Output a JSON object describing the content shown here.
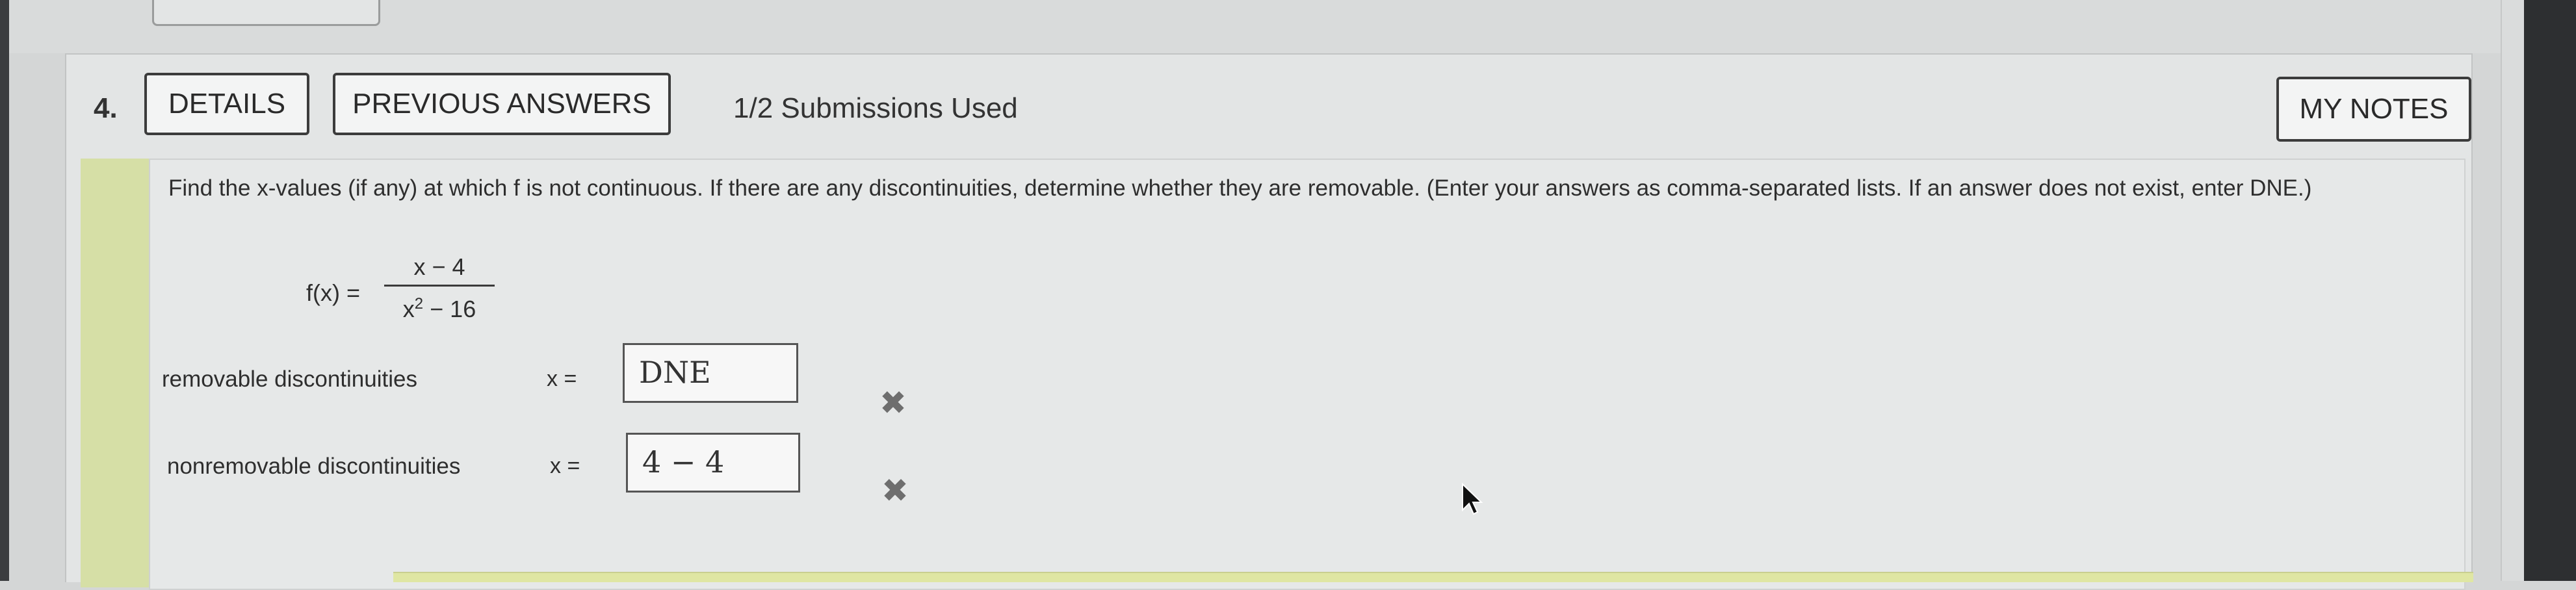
{
  "question": {
    "number": "4.",
    "details_label": "DETAILS",
    "previous_answers_label": "PREVIOUS ANSWERS",
    "submissions": "1/2 Submissions Used",
    "my_notes_label": "MY NOTES",
    "prompt": "Find the x-values (if any) at which f is not continuous. If there are any discontinuities, determine whether they are removable. (Enter your answers as comma-separated lists. If an answer does not exist, enter DNE.)",
    "function": {
      "lhs": "f(x) =",
      "numerator": "x − 4",
      "denominator_base": "x",
      "denominator_exp": "2",
      "denominator_rest": " − 16"
    },
    "rows": [
      {
        "label": "removable discontinuities",
        "x_label": "x =",
        "answer": "DNE",
        "status": "incorrect"
      },
      {
        "label": "nonremovable discontinuities",
        "x_label": "x =",
        "answer": "4 − 4",
        "status": "incorrect"
      }
    ],
    "incorrect_mark": "✖"
  },
  "colors": {
    "accent_green": "#d6dfa6",
    "incorrect_mark": "#6e6e6e"
  }
}
